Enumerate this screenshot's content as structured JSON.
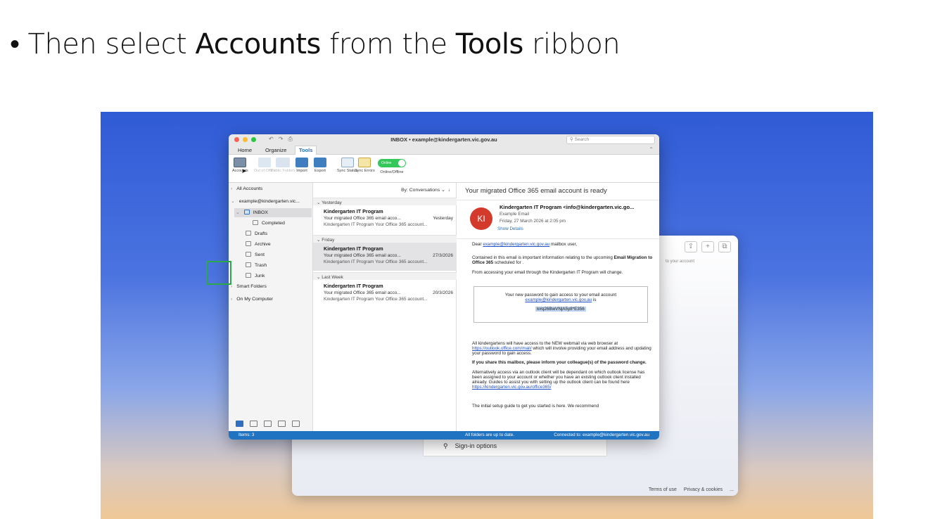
{
  "slide": {
    "bullet": "•",
    "t1": "Then select ",
    "t2": "Accounts",
    "t3": " from the ",
    "t4": "Tools",
    "t5": " ribbon"
  },
  "signin_window": {
    "side_text": "to your account",
    "sign_in_options": "Sign-in options",
    "terms": "Terms of use",
    "privacy": "Privacy & cookies",
    "more": "..."
  },
  "window": {
    "title": "INBOX • example@kindergarten.vic.gov.au",
    "search_placeholder": "Search",
    "undo": "↶",
    "redo": "↷",
    "print": "⎙"
  },
  "tabs": {
    "home": "Home",
    "organize": "Organize",
    "tools": "Tools"
  },
  "ribbon": {
    "accounts": "Accounts",
    "out_of_office": "Out of Office",
    "public_folders": "Public Folders",
    "import": "Import",
    "export": "Export",
    "sync_status": "Sync Status",
    "sync_errors": "Sync Errors",
    "online_toggle": "Online",
    "online_offline": "Online/Offline"
  },
  "sidebar": {
    "all_accounts": "All Accounts",
    "account": "example@kindergarten.vic...",
    "inbox": "INBOX",
    "completed": "Completed",
    "drafts": "Drafts",
    "archive": "Archive",
    "sent": "Sent",
    "trash": "Trash",
    "junk": "Junk",
    "smart_folders": "Smart Folders",
    "on_my_computer": "On My Computer"
  },
  "message_list": {
    "sort_label": "By: Conversations",
    "groups": [
      "Yesterday",
      "Friday",
      "Last Week"
    ],
    "messages": [
      {
        "sender": "Kindergarten IT Program",
        "subject": "Your migrated Office 365 email acco...",
        "date": "Yesterday",
        "preview": "Kindergarten IT Program Your Office 365 account..."
      },
      {
        "sender": "Kindergarten IT Program",
        "subject": "Your migrated Office 365 email acco...",
        "date": "27/3/2026",
        "preview": "Kindergarten IT Program Your Office 365 account..."
      },
      {
        "sender": "Kindergarten IT Program",
        "subject": "Your migrated Office 365 email acco...",
        "date": "20/3/2026",
        "preview": "Kindergarten IT Program Your Office 365 account..."
      }
    ]
  },
  "reading": {
    "subject": "Your migrated Office 365 email account is ready",
    "avatar_initials": "KI",
    "from": "Kindergarten IT Program <info@kindergarten.vic.go...",
    "from_name": "Example Email",
    "date": "Friday, 27 March 2026 at 2:05 pm",
    "show_details": "Show Details",
    "dear": "Dear ",
    "dear_email": "example@kindergarten.vic.gov.au",
    "dear_rest": " mailbox user,",
    "p1a": "Contained in this email is important information relating to the upcoming ",
    "p1b": "Email Migration to Office 365",
    "p1c": " scheduled for .",
    "p2": "From accessing your email through the Kindergarten IT Program will change.",
    "pw_line1": "Your new password to gain access to your email account",
    "pw_email": "example@kindergarten.vic.gov.au",
    "pw_is": " is",
    "pw_value": "k#q26BwVNjA5y8*E356",
    "p3a": "All kindergartens will have access to the NEW webmail via web browser at ",
    "p3_link": "https://outlook.office.com/mail/",
    "p3b": " which will involve providing your email address and updating your password to gain access.",
    "p4": "If you share this mailbox, please inform your colleague(s) of the password change.",
    "p5a": "Alternatively access via an outlook client will be dependant on which outlook license has been assigned to your account or whether you have an existing outlook client installed already. Guides to assist you with setting up the outlook client can be found here ",
    "p5_link": "https://kindergarten.vic.gov.au/office365/",
    "p6": "The initial setup guide to get you started is here. We recommend"
  },
  "status": {
    "items": "Items: 3",
    "updated": "All folders are up to date.",
    "connected": "Connected to: example@kindergarten.vic.gov.au"
  }
}
